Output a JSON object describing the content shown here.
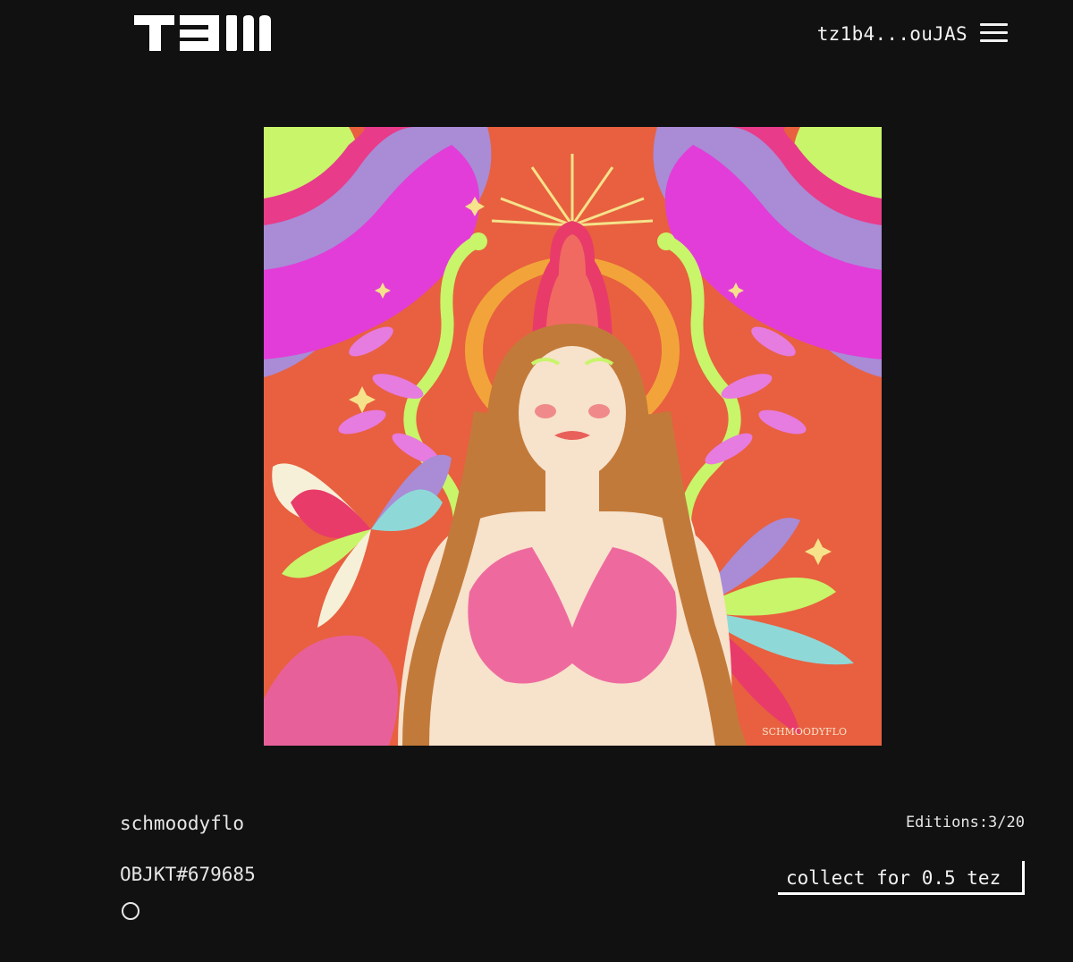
{
  "header": {
    "logo_text": "TEIA",
    "wallet_address": "tz1b4...ouJAS",
    "menu_icon": "hamburger-menu-icon"
  },
  "artwork": {
    "signature": "SCHMOODYFLO"
  },
  "details": {
    "artist": "schmoodyflo",
    "editions": "Editions:3/20",
    "objkt_id": "OBJKT#679685",
    "collect_label": "collect for 0.5 tez"
  },
  "colors": {
    "background": "#111111",
    "text": "#e6e6e6",
    "art_base": "#e8603f"
  }
}
